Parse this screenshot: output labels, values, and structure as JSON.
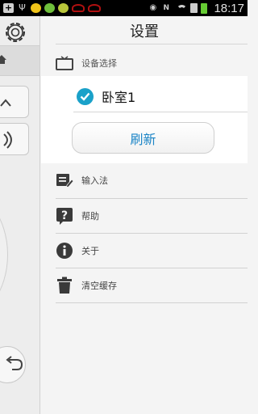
{
  "status_bar": {
    "time": "18:17",
    "icons": [
      "plus-icon",
      "usb-icon",
      "app-icon",
      "app-icon",
      "app-icon",
      "car-icon",
      "car-icon",
      "eye-icon",
      "nfc-icon",
      "wifi-icon",
      "sim-icon",
      "battery-icon"
    ]
  },
  "settings": {
    "title": "设置",
    "device_section": {
      "label": "设备选择",
      "icon": "tv-icon"
    },
    "device": {
      "name": "卧室1",
      "selected": true
    },
    "refresh_button": "刷新",
    "menu": [
      {
        "label": "输入法",
        "icon": "keyboard-edit-icon"
      },
      {
        "label": "帮助",
        "icon": "help-icon"
      },
      {
        "label": "关于",
        "icon": "info-icon"
      },
      {
        "label": "清空缓存",
        "icon": "trash-icon"
      }
    ]
  },
  "colors": {
    "accent": "#1aa1c9",
    "button_text": "#1a84c6",
    "background": "#f4f4f4"
  }
}
